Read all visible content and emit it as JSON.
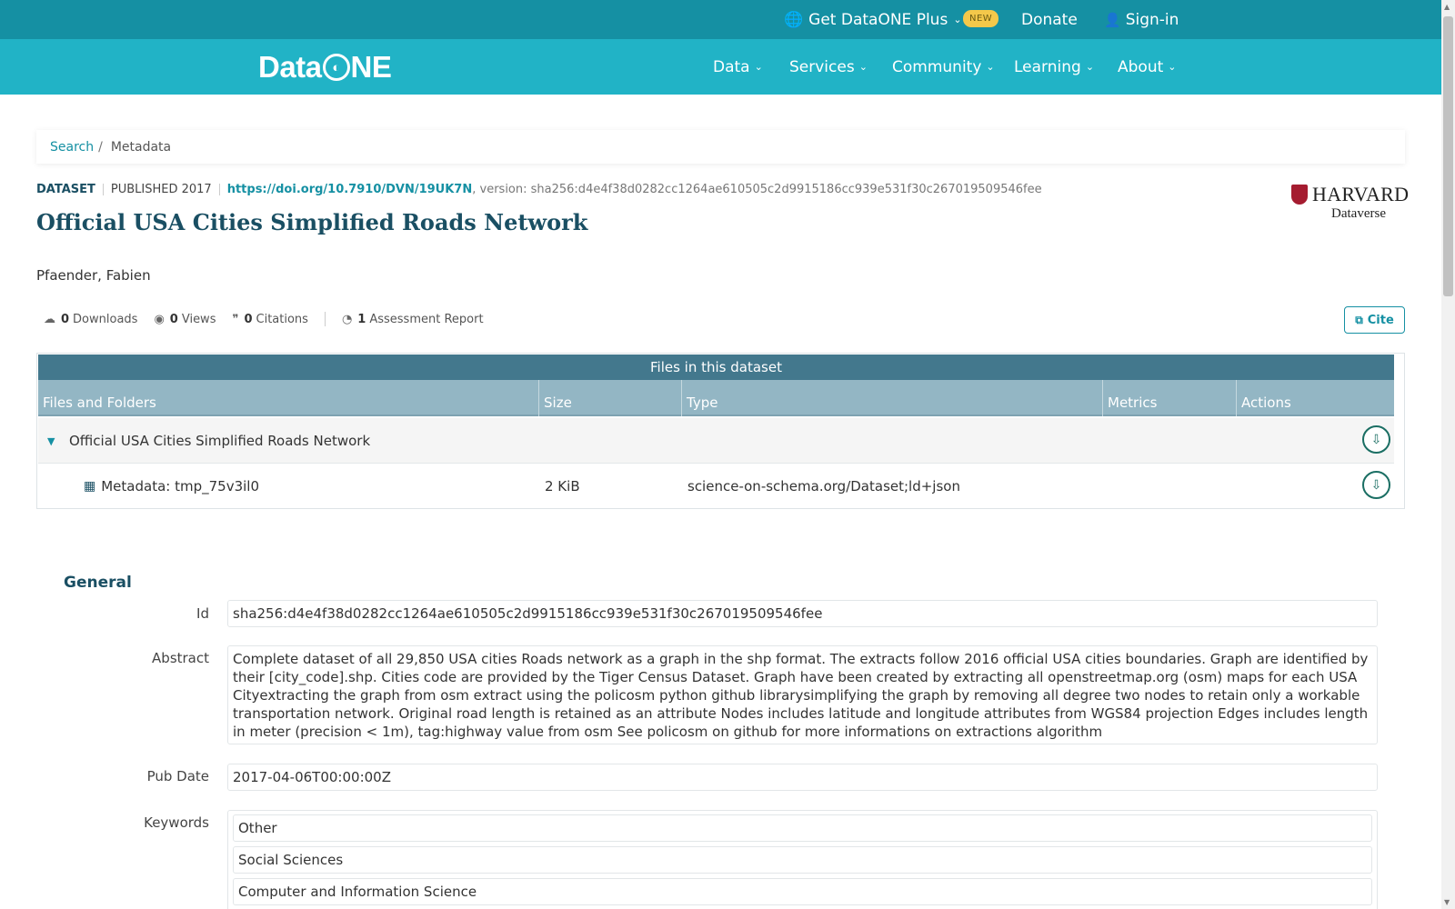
{
  "topbar": {
    "plus_label": "Get DataONE Plus",
    "new_badge": "NEW",
    "donate": "Donate",
    "signin": "Sign-in"
  },
  "nav": {
    "logo_pre": "Data",
    "logo_post": "NE",
    "items": [
      "Data",
      "Services",
      "Community",
      "Learning",
      "About"
    ]
  },
  "breadcrumb": {
    "search": "Search",
    "separator": "/",
    "current": "Metadata"
  },
  "dataset": {
    "type": "DATASET",
    "published": "PUBLISHED 2017",
    "doi": "https://doi.org/10.7910/DVN/19UK7N",
    "version": ", version: sha256:d4e4f38d0282cc1264ae610505c2d9915186cc939e531f30c267019509546fee",
    "title": "Official USA Cities Simplified Roads Network",
    "author": "Pfaender, Fabien",
    "repository_line1": "HARVARD",
    "repository_line2": "Dataverse"
  },
  "stats": {
    "downloads_count": "0",
    "downloads_label": "Downloads",
    "views_count": "0",
    "views_label": "Views",
    "citations_count": "0",
    "citations_label": "Citations",
    "assessment_count": "1",
    "assessment_label": "Assessment Report",
    "cite_button": "Cite"
  },
  "files": {
    "title": "Files in this dataset",
    "columns": [
      "Files and Folders",
      "Size",
      "Type",
      "Metrics",
      "Actions"
    ],
    "folder": "Official USA Cities Simplified Roads Network",
    "rows": [
      {
        "name": "Metadata: tmp_75v3il0",
        "size": "2 KiB",
        "type": "science-on-schema.org/Dataset;ld+json"
      }
    ]
  },
  "general": {
    "heading": "General",
    "id_label": "Id",
    "id": "sha256:d4e4f38d0282cc1264ae610505c2d9915186cc939e531f30c267019509546fee",
    "abstract_label": "Abstract",
    "abstract": "Complete dataset of all 29,850 USA cities Roads network as a graph in the shp format. The extracts follow 2016 official USA cities boundaries. Graph are identified by their [city_code].shp. Cities code are provided by the Tiger Census Dataset. Graph have been created by extracting all openstreetmap.org (osm) maps for each USA Cityextracting the graph from osm extract using the policosm python github librarysimplifying the graph by removing all degree two nodes to retain only a workable transportation network. Original road length is retained as an attribute Nodes includes latitude and longitude attributes from WGS84 projection Edges includes length in meter (precision < 1m), tag:highway value from osm See policosm on github for more informations on extractions algorithm",
    "pubdate_label": "Pub Date",
    "pubdate": "2017-04-06T00:00:00Z",
    "keywords_label": "Keywords",
    "keywords": [
      "Other",
      "Social Sciences",
      "Computer and Information Science"
    ]
  },
  "colors": {
    "topbar": "#1590a3",
    "nav": "#21b3c6",
    "title": "#1a4f63",
    "table_header": "#43788d"
  }
}
